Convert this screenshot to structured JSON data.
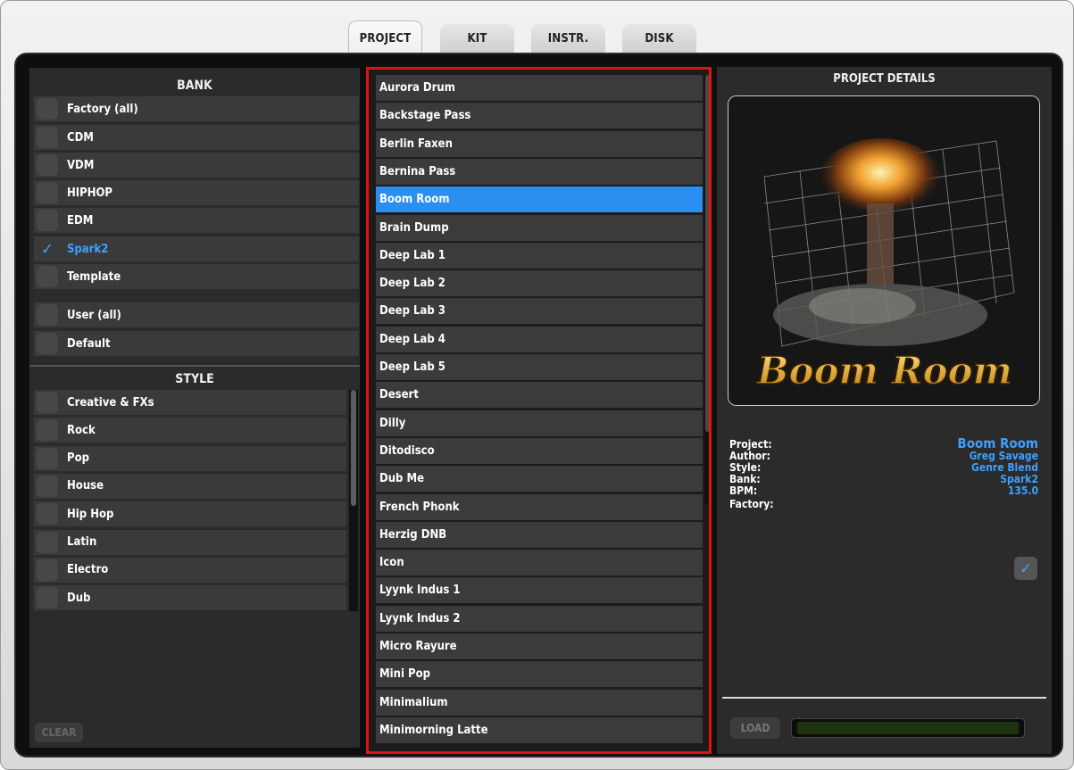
{
  "tabs": [
    {
      "label": "PROJECT",
      "active": true
    },
    {
      "label": "KIT",
      "active": false
    },
    {
      "label": "INSTR.",
      "active": false
    },
    {
      "label": "DISK",
      "active": false
    }
  ],
  "bank": {
    "header": "BANK",
    "items": [
      {
        "label": "Factory (all)",
        "checked": false
      },
      {
        "label": "CDM",
        "checked": false
      },
      {
        "label": "VDM",
        "checked": false
      },
      {
        "label": "HIPHOP",
        "checked": false
      },
      {
        "label": "EDM",
        "checked": false
      },
      {
        "label": "Spark2",
        "checked": true
      },
      {
        "label": "Template",
        "checked": false
      },
      {
        "label": "User (all)",
        "checked": false
      },
      {
        "label": "Default",
        "checked": false
      }
    ]
  },
  "style": {
    "header": "STYLE",
    "items": [
      {
        "label": "Creative & FXs"
      },
      {
        "label": "Rock"
      },
      {
        "label": "Pop"
      },
      {
        "label": "House"
      },
      {
        "label": "Hip Hop"
      },
      {
        "label": "Latin"
      },
      {
        "label": "Electro"
      },
      {
        "label": "Dub"
      }
    ]
  },
  "clear_label": "CLEAR",
  "projects": {
    "items": [
      "Aurora Drum",
      "Backstage Pass",
      "Berlin Faxen",
      "Bernina Pass",
      "Boom Room",
      "Brain Dump",
      "Deep Lab 1",
      "Deep Lab 2",
      "Deep Lab 3",
      "Deep Lab 4",
      "Deep Lab 5",
      "Desert",
      "Dilly",
      "Ditodisco",
      "Dub Me",
      "French Phonk",
      "Herzig DNB",
      "Icon",
      "Lyynk Indus 1",
      "Lyynk Indus 2",
      "Micro Rayure",
      "Mini Pop",
      "Minimalium",
      "Minimorning Latte"
    ],
    "selected": "Boom Room"
  },
  "details": {
    "header": "PROJECT DETAILS",
    "art_title": "Boom Room",
    "labels": {
      "project": "Project:",
      "author": "Author:",
      "style": "Style:",
      "bank": "Bank:",
      "bpm": "BPM:",
      "factory": "Factory:"
    },
    "values": {
      "project": "Boom Room",
      "author": "Greg Savage",
      "style": "Genre Blend",
      "bank": "Spark2",
      "bpm": "135.0",
      "factory": true
    }
  },
  "load_label": "LOAD",
  "colors": {
    "accent": "#3ea0ff",
    "highlight_border": "#e01212",
    "selected_row": "#2a8ff0"
  }
}
